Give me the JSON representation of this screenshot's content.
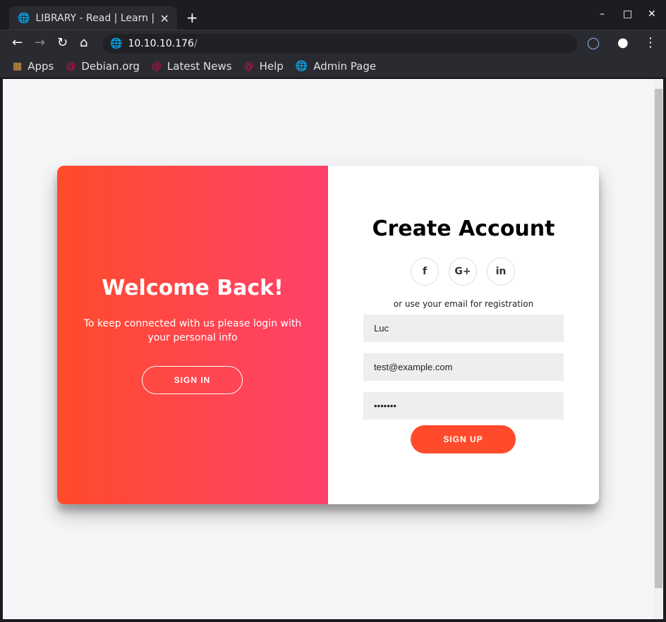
{
  "browser": {
    "tab_title": "LIBRARY - Read | Learn | Have Fun",
    "url_host": "10.10.10.176",
    "url_path": "/",
    "bookmarks": [
      {
        "label": "Apps",
        "icon": "apps-grid-icon"
      },
      {
        "label": "Debian.org",
        "icon": "debian-icon"
      },
      {
        "label": "Latest News",
        "icon": "debian-icon"
      },
      {
        "label": "Help",
        "icon": "debian-icon"
      },
      {
        "label": "Admin Page",
        "icon": "globe-icon"
      }
    ]
  },
  "welcome": {
    "title": "Welcome Back!",
    "text": "To keep connected with us please login with your personal info",
    "button": "SIGN IN"
  },
  "signup": {
    "title": "Create Account",
    "social": [
      "f",
      "G+",
      "in"
    ],
    "or_text": "or use your email for registration",
    "name_value": "Luc",
    "email_value": "test@example.com",
    "password_value": "•••••••",
    "button": "SIGN UP"
  },
  "colors": {
    "brand": "#ff4b2b",
    "gradient_end": "#ff416c"
  }
}
